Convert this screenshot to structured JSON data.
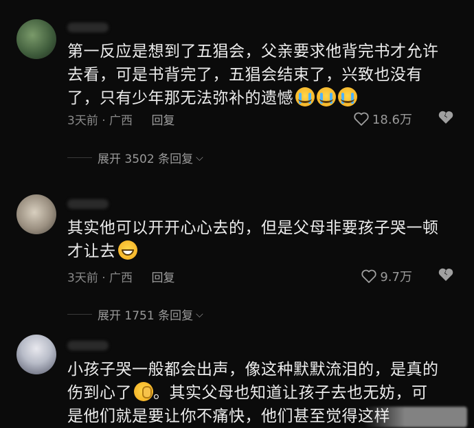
{
  "comments": [
    {
      "text_lines": [
        "第一反应是想到了五猖会，父亲要求他背完书才允许",
        "去看，可是书背完了，五猖会结束了，兴致也没有",
        "了，只有少年那无法弥补的遗憾"
      ],
      "time_location": "3天前 · 广西",
      "reply_label": "回复",
      "likes": "18.6万",
      "expand_label": "展开 3502 条回复"
    },
    {
      "text_lines": [
        "其实他可以开开心心去的，但是父母非要孩子哭一顿",
        "才让去"
      ],
      "time_location": "3天前 · 广西",
      "reply_label": "回复",
      "likes": "9.7万",
      "expand_label": "展开 1751 条回复"
    },
    {
      "text_lines": [
        "小孩子哭一般都会出声，像这种默默流泪的，是真的",
        "伤到心了",
        "。其实父母也知道让孩子去也无妨，可",
        "是他们就是要让你不痛快，他们甚至觉得这样"
      ]
    }
  ],
  "icons": {
    "like": "heart-outline-icon",
    "dislike": "broken-heart-icon",
    "expand": "chevron-down-icon"
  }
}
